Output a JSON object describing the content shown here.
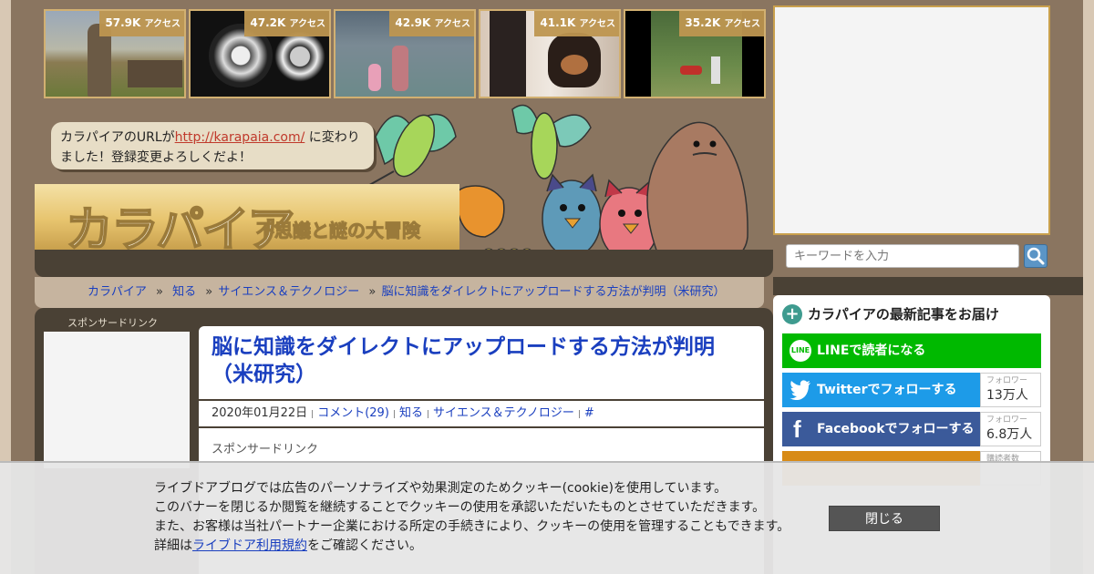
{
  "thumbnails": [
    {
      "count": "57.9K",
      "unit": "アクセス"
    },
    {
      "count": "47.2K",
      "unit": "アクセス"
    },
    {
      "count": "42.9K",
      "unit": "アクセス"
    },
    {
      "count": "41.1K",
      "unit": "アクセス"
    },
    {
      "count": "35.2K",
      "unit": "アクセス"
    }
  ],
  "notice": {
    "prefix": "カラパイアのURLが",
    "url": "http://karapaia.com/",
    "suffix": " に変わりました！登録変更よろしくだよ！"
  },
  "logo": {
    "main": "カラパイア",
    "tagline": "不思議と謎の大冒険"
  },
  "breadcrumb": {
    "items": [
      "カラパイア",
      "知る",
      "サイエンス＆テクノロジー",
      "脳に知識をダイレクトにアップロードする方法が判明（米研究）"
    ],
    "separator": "»"
  },
  "sidebar_left": {
    "sponsor_label": "スポンサードリンク"
  },
  "article": {
    "title": "脳に知識をダイレクトにアップロードする方法が判明（米研究）",
    "date": "2020年01月22日",
    "comments": "コメント(29)",
    "category1": "知る",
    "category2": "サイエンス＆テクノロジー",
    "hash": "#",
    "sponsor_label": "スポンサードリンク"
  },
  "search": {
    "placeholder": "キーワードを入力"
  },
  "follow": {
    "title": "カラパイアの最新記事をお届け",
    "line_label": "LINEで読者になる",
    "twitter_label": "Twitterでフォローする",
    "twitter_count_label": "フォロワー",
    "twitter_count": "13万人",
    "facebook_label": "Facebookでフォローする",
    "facebook_count_label": "フォロワー",
    "facebook_count": "6.8万人",
    "extra_count_label": "購読者数"
  },
  "cookie": {
    "line1": "ライブドアブログでは広告のパーソナライズや効果測定のためクッキー(cookie)を使用しています。",
    "line2": "このバナーを閉じるか閲覧を継続することでクッキーの使用を承認いただいたものとさせていただきます。",
    "line3": "また、お客様は当社パートナー企業における所定の手続きにより、クッキーの使用を管理することもできます。",
    "line4_prefix": "詳細は",
    "line4_link": "ライブドア利用規約",
    "line4_suffix": "をご確認ください。",
    "close_label": "閉じる"
  },
  "colors": {
    "page_bg": "#8a7560",
    "dark_bar": "#4a4135",
    "link_blue": "#1a3fbf",
    "badge_gold": "#be9650",
    "line_green": "#00b900",
    "twitter_blue": "#1d9be8",
    "facebook_blue": "#3b5a9a"
  }
}
